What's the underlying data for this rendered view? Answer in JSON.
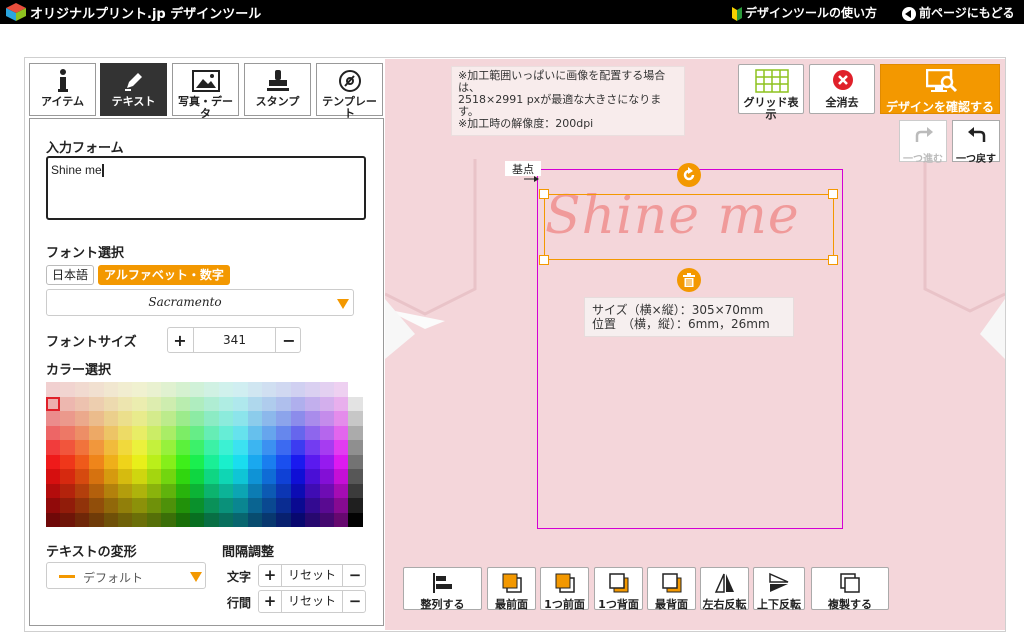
{
  "header": {
    "logo_text": "オリジナルプリント.jp デザインツール",
    "help_link": "デザインツールの使い方",
    "back_link": "前ページにもどる"
  },
  "tabs": [
    {
      "label": "アイテム",
      "icon": "info-icon",
      "active": false
    },
    {
      "label": "テキスト",
      "icon": "pen-icon",
      "active": true
    },
    {
      "label": "写真・データ",
      "icon": "image-icon",
      "active": false
    },
    {
      "label": "スタンプ",
      "icon": "stamp-icon",
      "active": false
    },
    {
      "label": "テンプレート",
      "icon": "template-icon",
      "active": false
    }
  ],
  "text_panel": {
    "input_label": "入力フォーム",
    "input_value": "Shine me",
    "font_label": "フォント選択",
    "font_tabs": [
      "日本語",
      "アルファベット・数字"
    ],
    "font_value": "Sacramento",
    "font_size_label": "フォントサイズ",
    "font_size_value": "341",
    "font_size_plus": "+",
    "font_size_minus": "−",
    "color_label": "カラー選択",
    "transform_label": "テキストの変形",
    "transform_value": "デフォルト",
    "spacing_label": "間隔調整",
    "char_spacing_label": "文字",
    "line_spacing_label": "行間",
    "reset_label": "リセット",
    "plus": "+",
    "minus": "−"
  },
  "canvas": {
    "info_text": "※加工範囲いっぱいに画像を配置する場合は、\n2518×2991 pxが最適な大きさになります。\n※加工時の解像度：200dpi",
    "grid_button": "グリッド表示",
    "clear_button": "全消去",
    "confirm_button": "デザインを確認する",
    "redo_button": "一つ進む",
    "undo_button": "一つ戻す",
    "base_label": "基点",
    "design_text": "Shine me",
    "size_info_line1": "サイズ（横×縦）：305×70mm",
    "size_info_line2": "位置　（横，縦）：6mm，26mm",
    "shirt_color": "#f4d6da",
    "accent_color": "#f39800"
  },
  "toolbar": [
    {
      "label": "整列する",
      "icon": "align-icon"
    },
    {
      "label": "最前面",
      "icon": "bring-front-icon"
    },
    {
      "label": "1つ前面",
      "icon": "bring-forward-icon"
    },
    {
      "label": "1つ背面",
      "icon": "send-backward-icon"
    },
    {
      "label": "最背面",
      "icon": "send-back-icon"
    },
    {
      "label": "左右反転",
      "icon": "flip-horizontal-icon"
    },
    {
      "label": "上下反転",
      "icon": "flip-vertical-icon"
    },
    {
      "label": "複製する",
      "icon": "duplicate-icon"
    }
  ]
}
